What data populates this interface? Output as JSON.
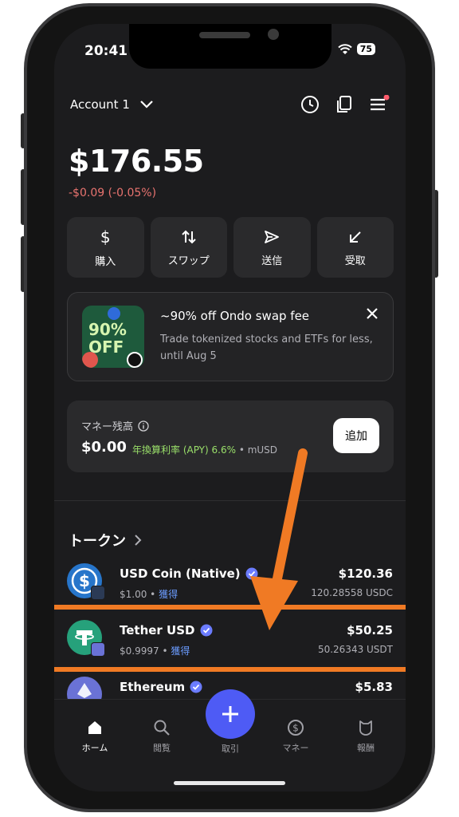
{
  "status": {
    "time": "20:41",
    "battery": "75"
  },
  "header": {
    "account_label": "Account 1"
  },
  "balance": {
    "total": "$176.55",
    "change": "-$0.09 (-0.05%)"
  },
  "actions": [
    {
      "label": "購入"
    },
    {
      "label": "スワップ"
    },
    {
      "label": "送信"
    },
    {
      "label": "受取"
    }
  ],
  "promo": {
    "title": "~90% off Ondo swap fee",
    "description": "Trade tokenized stocks and ETFs for less, until Aug 5",
    "badge_top": "90%",
    "badge_bottom": "OFF"
  },
  "money": {
    "title": "マネー残高",
    "value": "$0.00",
    "apy": "年換算利率 (APY) 6.6%",
    "source": " • mUSD",
    "add_label": "追加"
  },
  "tokens": {
    "title": "トークン",
    "items": [
      {
        "name": "USD Coin (Native)",
        "price": "$1.00",
        "earn": "獲得",
        "value": "$120.36",
        "amount": "120.28558 USDC",
        "color": "#2775ca"
      },
      {
        "name": "Tether USD",
        "price": "$0.9997",
        "earn": "獲得",
        "value": "$50.25",
        "amount": "50.26343 USDT",
        "color": "#26a17b"
      },
      {
        "name": "Ethereum",
        "price": "",
        "earn": "",
        "value": "$5.83",
        "amount": "",
        "color": "#6a72d6"
      }
    ]
  },
  "nav": {
    "items": [
      {
        "label": "ホーム"
      },
      {
        "label": "閲覧"
      },
      {
        "label": "取引"
      },
      {
        "label": "マネー"
      },
      {
        "label": "報酬"
      }
    ]
  },
  "colors": {
    "highlight": "#f07a24",
    "accent": "#4e5bf5",
    "negative": "#e8736f",
    "apy": "#9ae06a"
  }
}
